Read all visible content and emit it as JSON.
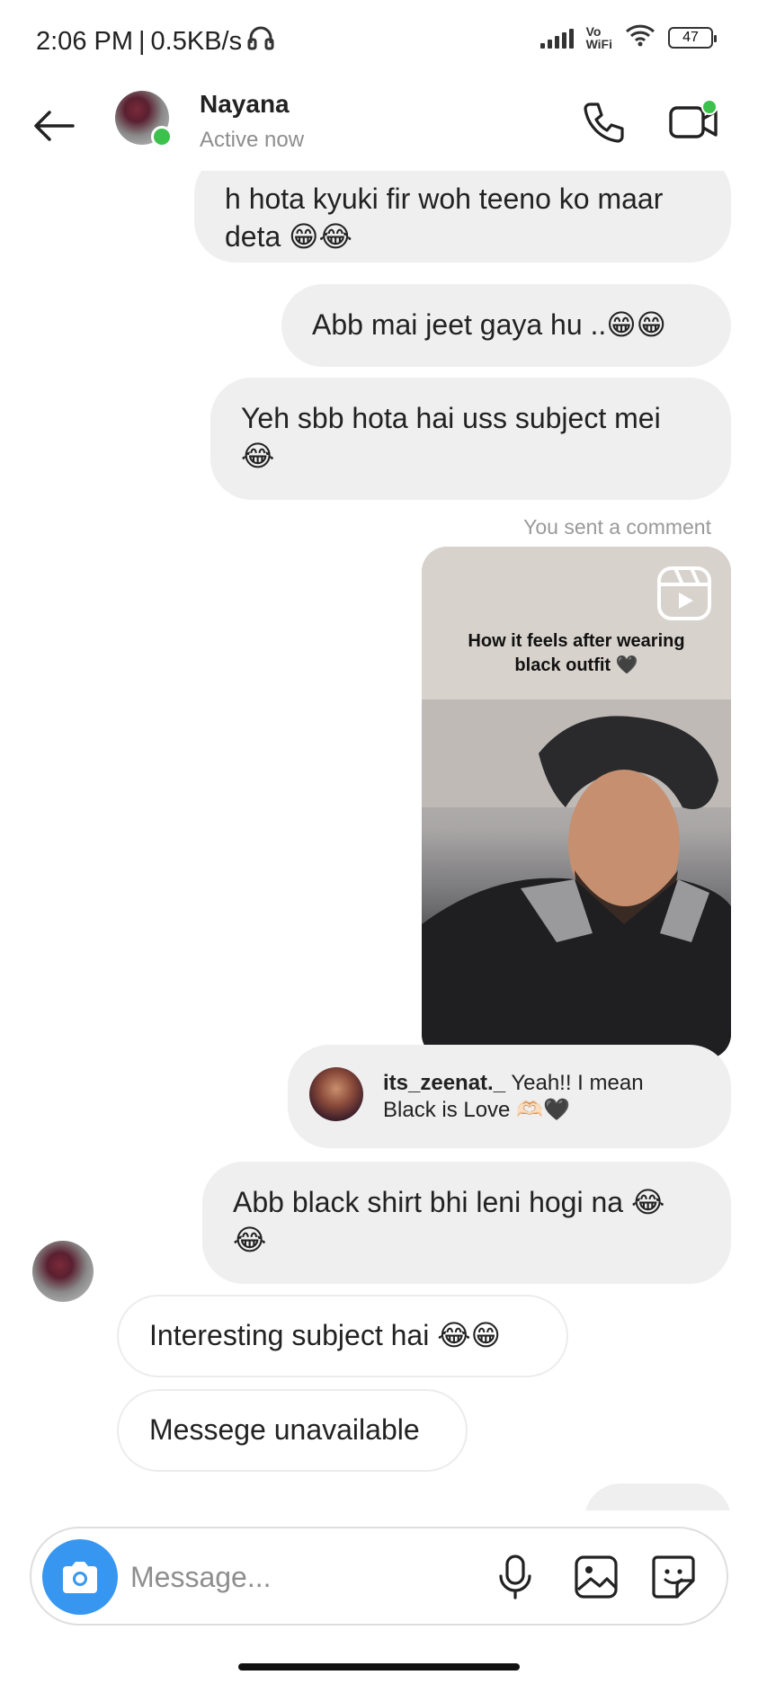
{
  "status_bar": {
    "time": "2:06 PM",
    "network_speed": "0.5KB/s",
    "vowifi_top": "Vo",
    "vowifi_bottom": "WiFi",
    "battery": "47"
  },
  "header": {
    "contact_name": "Nayana",
    "contact_status": "Active now",
    "icons": [
      "back-arrow-icon",
      "phone-icon",
      "video-camera-icon"
    ]
  },
  "messages": [
    {
      "line1": "h hota kyuki fir woh teeno ko maar",
      "line2": "deta 😁😂",
      "direction": "sent"
    },
    {
      "line1": "Abb mai jeet gaya hu ..😁😁",
      "direction": "sent"
    },
    {
      "line1": "Yeh sbb hota hai uss subject mei",
      "line2": "😂",
      "direction": "sent"
    },
    {
      "line1": "Abb black shirt bhi leni hogi na 😂",
      "line2": "😂",
      "direction": "sent"
    },
    {
      "line1": "Interesting subject hai 😂😁",
      "direction": "received"
    },
    {
      "line1": "Messege unavailable",
      "direction": "received"
    }
  ],
  "shared_reel": {
    "label": "You sent a comment",
    "caption_line1": "How it feels after wearing",
    "caption_line2": "black outfit 🖤"
  },
  "comment": {
    "username": "its_zeenat._",
    "text_line1": "Yeah!! I mean",
    "text_line2": "Black is Love 🫶🏻🖤"
  },
  "composer": {
    "placeholder": "Message...",
    "icons": [
      "camera-icon",
      "microphone-icon",
      "gallery-icon",
      "sticker-icon"
    ]
  },
  "colors": {
    "accent": "#3797f0",
    "online": "#3cc14c",
    "sent_bubble": "#efefef"
  }
}
